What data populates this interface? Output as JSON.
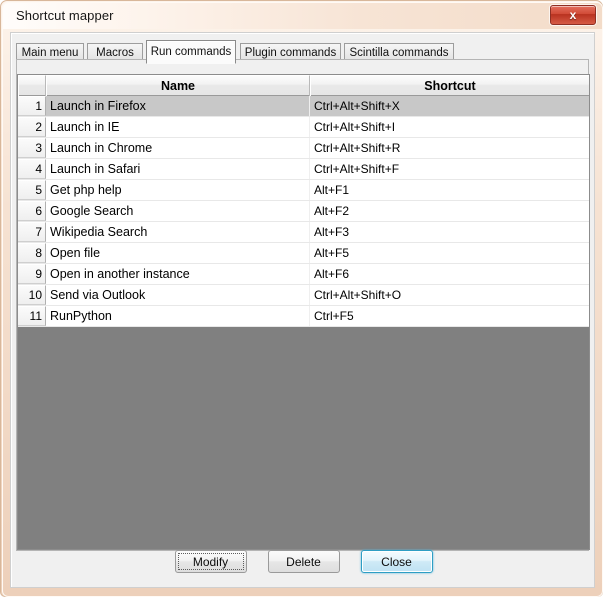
{
  "window": {
    "title": "Shortcut mapper",
    "close_icon": "close-x-icon",
    "close_label": "x"
  },
  "tabs": [
    {
      "label": "Main menu",
      "selected": false
    },
    {
      "label": "Macros",
      "selected": false
    },
    {
      "label": "Run commands",
      "selected": true
    },
    {
      "label": "Plugin commands",
      "selected": false
    },
    {
      "label": "Scintilla commands",
      "selected": false
    }
  ],
  "list": {
    "columns": [
      "",
      "Name",
      "Shortcut"
    ],
    "rows": [
      {
        "index": "1",
        "name": "Launch in Firefox",
        "shortcut": "Ctrl+Alt+Shift+X",
        "selected": true
      },
      {
        "index": "2",
        "name": "Launch in IE",
        "shortcut": "Ctrl+Alt+Shift+I",
        "selected": false
      },
      {
        "index": "3",
        "name": "Launch in Chrome",
        "shortcut": "Ctrl+Alt+Shift+R",
        "selected": false
      },
      {
        "index": "4",
        "name": "Launch in Safari",
        "shortcut": "Ctrl+Alt+Shift+F",
        "selected": false
      },
      {
        "index": "5",
        "name": "Get php help",
        "shortcut": "Alt+F1",
        "selected": false
      },
      {
        "index": "6",
        "name": "Google Search",
        "shortcut": "Alt+F2",
        "selected": false
      },
      {
        "index": "7",
        "name": "Wikipedia Search",
        "shortcut": "Alt+F3",
        "selected": false
      },
      {
        "index": "8",
        "name": "Open file",
        "shortcut": "Alt+F5",
        "selected": false
      },
      {
        "index": "9",
        "name": "Open in another instance",
        "shortcut": "Alt+F6",
        "selected": false
      },
      {
        "index": "10",
        "name": "Send via Outlook",
        "shortcut": "Ctrl+Alt+Shift+O",
        "selected": false
      },
      {
        "index": "11",
        "name": "RunPython",
        "shortcut": "Ctrl+F5",
        "selected": false
      }
    ]
  },
  "buttons": [
    {
      "label": "Modify",
      "state": "focused"
    },
    {
      "label": "Delete",
      "state": "normal"
    },
    {
      "label": "Close",
      "state": "default"
    }
  ],
  "colors": {
    "frame": "#edd0ba",
    "titlebar_left": "#fffdfb",
    "close_red": "#d04a36",
    "list_background": "#808080",
    "selection": "#c8c8c8",
    "default_button_accent": "#2e9ec4"
  }
}
